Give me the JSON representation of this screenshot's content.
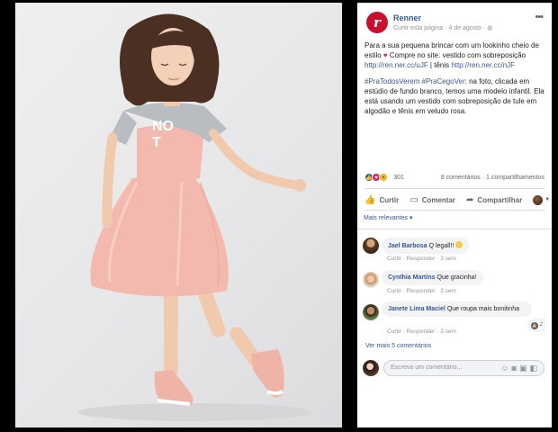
{
  "post": {
    "page_name": "Renner",
    "meta": "Curtir esta página · 4 de agosto · ",
    "text_intro": "Para a sua pequena brincar com um lookinho cheio de estilo ",
    "text_heart": "♥",
    "text_intro2": " Compre no site: vestido com sobreposição ",
    "link1": "http://ren.ner.cc/uJF",
    "text_sep": " | tênis ",
    "link2": "http://ren.ner.cc/nJF",
    "hashtags": "#PraTodosVerem #PraCegoVer",
    "desc": ": na foto, clicada em estúdio de fundo branco, temos uma modelo infantil. Ela está usando um vestido com sobreposição de tule em algodão e tênis em veludo rosa."
  },
  "stats": {
    "reaction_count": "301",
    "comments": "8 comentários",
    "shares": "1 compartilhamentos"
  },
  "actions": {
    "like": "Curtir",
    "comment": "Comentar",
    "share": "Compartilhar"
  },
  "filter": "Mais relevantes ▾",
  "comments": [
    {
      "author": "Jael Barbosa",
      "text": "Q legall!! ",
      "reply": "Curtir · Responder · 3 sem"
    },
    {
      "author": "Cynthia Martins",
      "text": "Que gracinha!",
      "reply": "Curtir · Responder · 3 sem"
    },
    {
      "author": "Janete Lima Maciel",
      "text": "Que roupa mais bonitinha",
      "reply": "Curtir · Responder · 3 sem",
      "likes": "2"
    }
  ],
  "more_comments": "Ver mais 5 comentários",
  "composer": {
    "placeholder": "Escreva um comentário..."
  },
  "colors": {
    "brand": "#c8102e",
    "link": "#385898",
    "dress": "#f4b9ae",
    "shirt": "#b9bcc1"
  }
}
